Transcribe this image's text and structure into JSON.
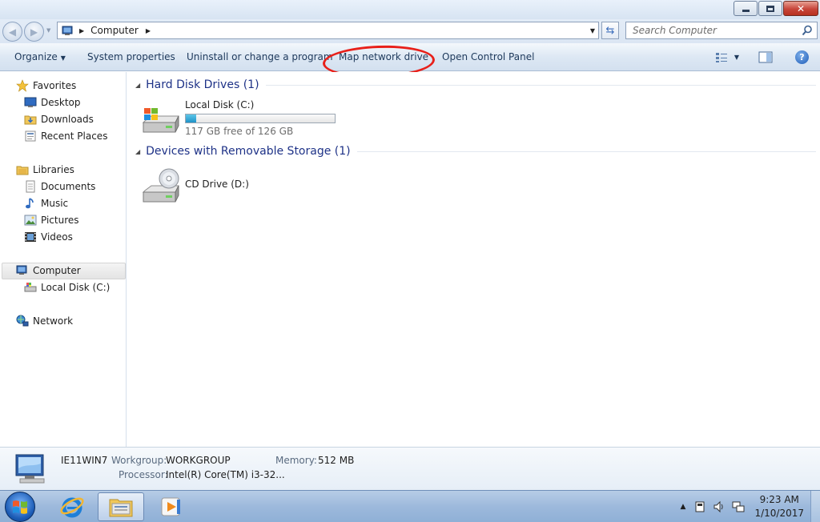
{
  "window": {
    "minimize_icon": "minimize-icon",
    "maximize_icon": "restore-icon",
    "close_icon": "close-icon",
    "close_color": "#c7453a"
  },
  "address": {
    "crumb": "Computer",
    "search_placeholder": "Search Computer"
  },
  "commands": {
    "organize": "Organize",
    "system_properties": "System properties",
    "uninstall": "Uninstall or change a program",
    "map_network_drive": "Map network drive",
    "open_control_panel": "Open Control Panel"
  },
  "annotation": {
    "color": "#e8201a",
    "target": "Map network drive"
  },
  "nav": {
    "favorites": "Favorites",
    "desktop": "Desktop",
    "downloads": "Downloads",
    "recent_places": "Recent Places",
    "libraries": "Libraries",
    "documents": "Documents",
    "music": "Music",
    "pictures": "Pictures",
    "videos": "Videos",
    "computer": "Computer",
    "local_disk": "Local Disk (C:)",
    "network": "Network"
  },
  "content": {
    "hdd_group": "Hard Disk Drives (1)",
    "local_disk_name": "Local Disk (C:)",
    "local_disk_free": "117 GB free of 126 GB",
    "local_disk_used_fraction": 0.071,
    "removable_group": "Devices with Removable Storage (1)",
    "cd_drive_name": "CD Drive (D:)"
  },
  "details": {
    "computer_name": "IE11WIN7",
    "workgroup_label": "Workgroup:",
    "workgroup_value": "WORKGROUP",
    "memory_label": "Memory:",
    "memory_value": "512 MB",
    "processor_label": "Processor:",
    "processor_value": "Intel(R) Core(TM) i3-32..."
  },
  "taskbar": {
    "time": "9:23 AM",
    "date": "1/10/2017"
  }
}
